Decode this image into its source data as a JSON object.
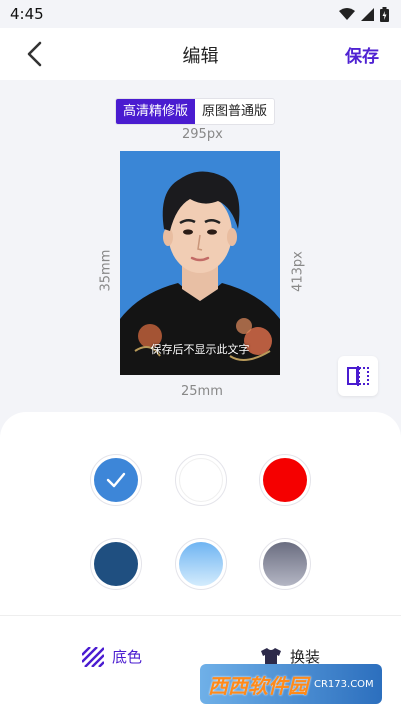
{
  "status_bar": {
    "time": "4:45"
  },
  "header": {
    "title": "编辑",
    "save_label": "保存"
  },
  "mode_toggle": {
    "options": [
      "高清精修版",
      "原图普通版"
    ],
    "selected": "高清精修版"
  },
  "photo": {
    "width_px_label": "295px",
    "height_px_label": "413px",
    "width_mm_label": "25mm",
    "height_mm_label": "35mm",
    "watermark_note": "保存后不显示此文字",
    "background_color": "#3a86d6"
  },
  "colors": {
    "row1": [
      {
        "name": "blue",
        "hex": "#3d86d8",
        "selected": true
      },
      {
        "name": "white",
        "hex": "#ffffff",
        "selected": false
      },
      {
        "name": "red",
        "hex": "#f50000",
        "selected": false
      }
    ],
    "row2": [
      {
        "name": "dark-blue",
        "hex": "#1f4f80",
        "selected": false
      },
      {
        "name": "light-blue-gradient",
        "hex": "#a9d2f7",
        "selected": false
      },
      {
        "name": "gray-gradient",
        "hex": "#8a8c9e",
        "selected": false
      }
    ],
    "accent": "#4a1cd0"
  },
  "tabs": [
    {
      "label": "底色",
      "icon": "stripes-icon",
      "active": true
    },
    {
      "label": "换装",
      "icon": "shirt-icon",
      "active": false
    }
  ],
  "logo": {
    "text": "西西软件园",
    "sub": "CR173.COM"
  }
}
